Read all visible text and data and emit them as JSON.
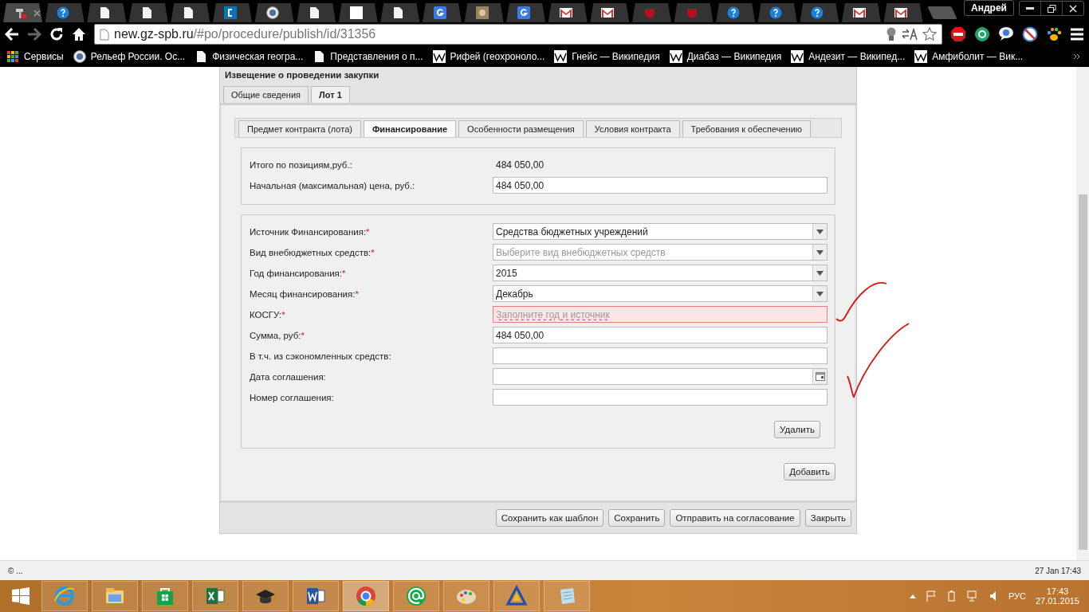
{
  "browser": {
    "tabs": [
      {
        "kind": "tools",
        "selected": true
      },
      {
        "kind": "help",
        "selected": false
      },
      {
        "kind": "page",
        "selected": false
      },
      {
        "kind": "page",
        "selected": false
      },
      {
        "kind": "page",
        "selected": false
      },
      {
        "kind": "c",
        "selected": false
      },
      {
        "kind": "seal",
        "selected": false
      },
      {
        "kind": "page",
        "selected": false
      },
      {
        "kind": "blank",
        "selected": false
      },
      {
        "kind": "page",
        "selected": false
      },
      {
        "kind": "g",
        "selected": false
      },
      {
        "kind": "photo",
        "selected": false
      },
      {
        "kind": "g",
        "selected": false
      },
      {
        "kind": "mail",
        "selected": false
      },
      {
        "kind": "mail",
        "selected": false
      },
      {
        "kind": "nfl",
        "selected": false
      },
      {
        "kind": "nfl",
        "selected": false
      },
      {
        "kind": "help",
        "selected": false
      },
      {
        "kind": "help",
        "selected": false
      },
      {
        "kind": "help",
        "selected": false
      },
      {
        "kind": "mail",
        "selected": false
      },
      {
        "kind": "mail",
        "selected": false
      }
    ],
    "profile": "Андрей",
    "url": {
      "host": "new.gz-spb.ru",
      "path": "/#po/procedure/publish/id/31356"
    },
    "bookmarks": [
      {
        "kind": "apps",
        "label": "Сервисы"
      },
      {
        "kind": "seal",
        "label": "Рельеф России. Ос..."
      },
      {
        "kind": "page",
        "label": "Физическая геогра..."
      },
      {
        "kind": "page",
        "label": "Представления о п..."
      },
      {
        "kind": "wiki",
        "label": "Рифей (геохроноло..."
      },
      {
        "kind": "wiki",
        "label": "Гнейс — Википедия"
      },
      {
        "kind": "wiki",
        "label": "Диабаз — Википедия"
      },
      {
        "kind": "wiki",
        "label": "Андезит — Википед..."
      },
      {
        "kind": "wiki",
        "label": "Амфиболит — Вик..."
      }
    ]
  },
  "form": {
    "title": "Извещение о проведении закупки",
    "tabs": [
      {
        "label": "Общие сведения",
        "selected": false
      },
      {
        "label": "Лот 1",
        "selected": true
      }
    ],
    "subtabs": [
      {
        "label": "Предмет контракта (лота)",
        "selected": false
      },
      {
        "label": "Финансирование",
        "selected": true
      },
      {
        "label": "Особенности размещения",
        "selected": false
      },
      {
        "label": "Условия контракта",
        "selected": false
      },
      {
        "label": "Требования к обеспечению",
        "selected": false
      }
    ],
    "summary": [
      {
        "kind": "text",
        "label": "Итого по позициям,руб.:",
        "value": "484 050,00"
      },
      {
        "kind": "input",
        "label": "Начальная (максимальная) цена, руб.:",
        "value": "484 050,00"
      }
    ],
    "fields": [
      {
        "kind": "select",
        "label": "Источник Финансирования:",
        "required_mark": "*",
        "value": "Средства бюджетных учреждений"
      },
      {
        "kind": "select",
        "label": "Вид внебюджетных средств:",
        "required_mark": "*",
        "placeholder": "Выберите вид внебюджетных средств"
      },
      {
        "kind": "select",
        "label": "Год финансирования:",
        "required_mark": "*",
        "value": "2015"
      },
      {
        "kind": "select",
        "label": "Месяц финансирования:",
        "required_mark": "*",
        "value": "Декабрь"
      },
      {
        "kind": "input",
        "label": "КОСГУ:",
        "required_mark": "*",
        "placeholder": "Заполните год и источник",
        "error": true
      },
      {
        "kind": "input",
        "label": "Сумма, руб:",
        "required_mark": "*",
        "value": "484 050,00",
        "error": false
      },
      {
        "kind": "input",
        "label": "В т.ч. из сэкономленных средств:",
        "error": false
      },
      {
        "kind": "date",
        "label": "Дата соглашения:"
      },
      {
        "kind": "input",
        "label": "Номер соглашения:",
        "error": false
      }
    ],
    "delete_button": "Удалить",
    "add_button": "Добавить",
    "footer_buttons": [
      "Сохранить как шаблон",
      "Сохранить",
      "Отправить на согласование",
      "Закрыть"
    ]
  },
  "status_bar": {
    "left": "© ...",
    "right": "27 Jan 17:43"
  },
  "taskbar": {
    "apps": [
      {
        "kind": "ie",
        "selected": false
      },
      {
        "kind": "explorer",
        "selected": false
      },
      {
        "kind": "store",
        "selected": false
      },
      {
        "kind": "excel",
        "selected": false
      },
      {
        "kind": "hat",
        "selected": false
      },
      {
        "kind": "word",
        "selected": false
      },
      {
        "kind": "chrome",
        "selected": true
      },
      {
        "kind": "at",
        "selected": false
      },
      {
        "kind": "paint",
        "selected": false
      },
      {
        "kind": "triangle",
        "selected": false
      },
      {
        "kind": "notepad",
        "selected": false
      }
    ],
    "language": "РУС",
    "time": "17:43",
    "date": "27.01.2015"
  }
}
